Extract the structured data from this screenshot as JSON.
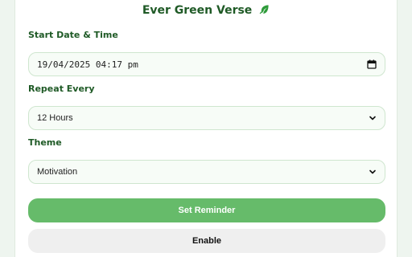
{
  "app": {
    "title": "Ever Green Verse",
    "accent_color": "#66bb6a",
    "title_color": "#1f5a26"
  },
  "form": {
    "start": {
      "label": "Start Date & Time",
      "value": "19/04/2025 04:17 pm",
      "icon": "calendar-icon"
    },
    "repeat": {
      "label": "Repeat Every",
      "value": "12 Hours",
      "icon": "chevron-down-icon"
    },
    "theme": {
      "label": "Theme",
      "value": "Motivation",
      "icon": "chevron-down-icon"
    }
  },
  "buttons": {
    "set_reminder": "Set Reminder",
    "enable": "Enable"
  }
}
